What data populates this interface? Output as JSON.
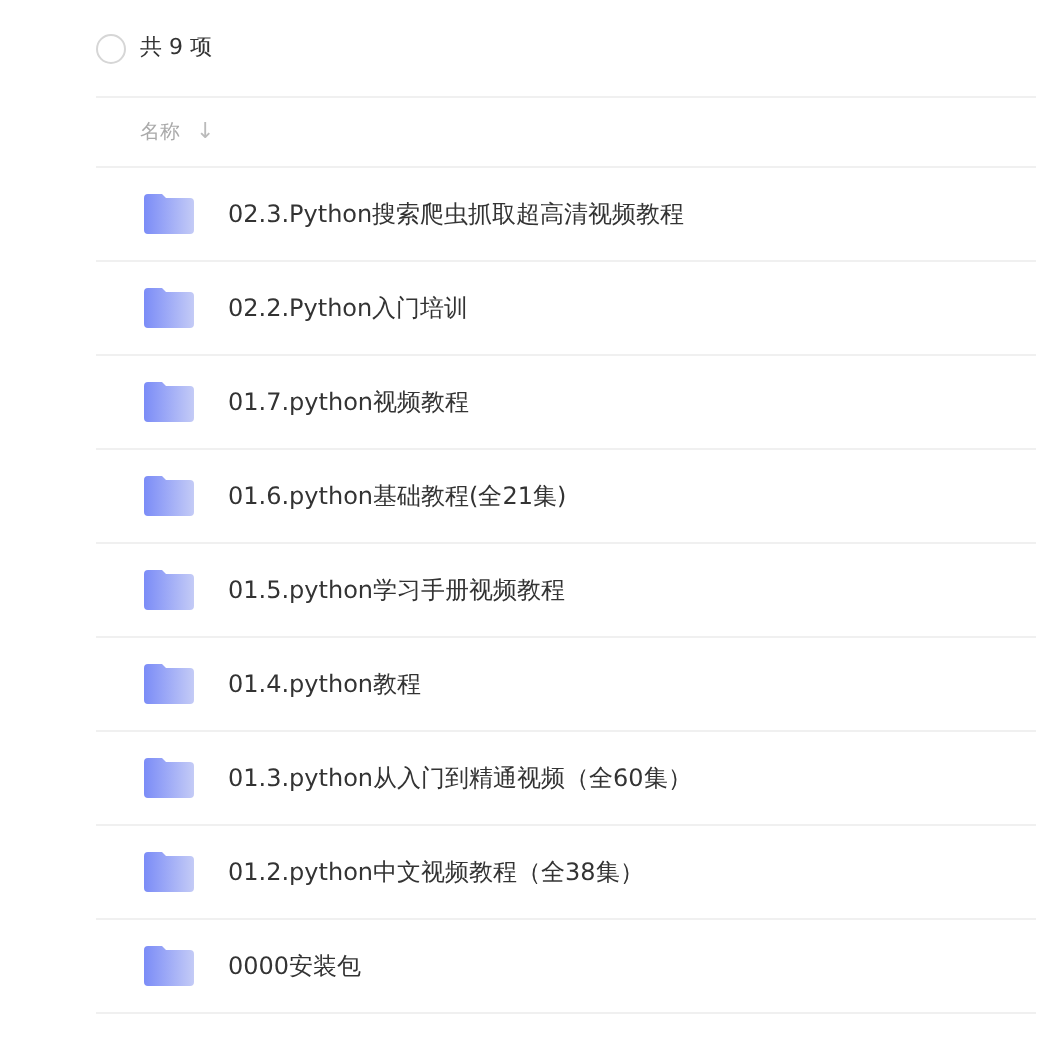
{
  "header": {
    "select_all": {
      "checked": false
    },
    "count": "共 9 项"
  },
  "columns": [
    {
      "label": "名称",
      "sort_arrow": "↓"
    }
  ],
  "rows": [
    {
      "name": "02.3.Python搜索爬虫抓取超高清视频教程"
    },
    {
      "name": "02.2.Python入门培训"
    },
    {
      "name": "01.7.python视频教程"
    },
    {
      "name": "01.6.python基础教程(全21集)"
    },
    {
      "name": "01.5.python学习手册视频教程"
    },
    {
      "name": "01.4.python教程"
    },
    {
      "name": "01.3.python从入门到精通视频（全60集）"
    },
    {
      "name": "01.2.python中文视频教程（全38集）"
    },
    {
      "name": "0000安装包"
    }
  ]
}
